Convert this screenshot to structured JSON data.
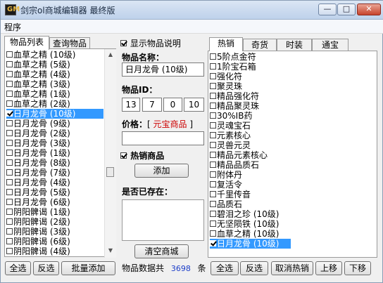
{
  "title": "剑宗ol商城编辑器 最终版",
  "app_icon_text": "GM",
  "window_buttons": {
    "min": "—",
    "max": "□",
    "close": "✕"
  },
  "menu": {
    "program": "程序"
  },
  "left": {
    "tabs": [
      "物品列表",
      "查询物品"
    ],
    "items": [
      "血草之精 (10级)",
      "血草之精 (5级)",
      "血草之精 (4级)",
      "血草之精 (3级)",
      "血草之精 (1级)",
      "血草之精 (2级)",
      "日月龙骨 (10级)",
      "日月龙骨 (9级)",
      "日月龙骨 (2级)",
      "日月龙骨 (3级)",
      "日月龙骨 (1级)",
      "日月龙骨 (8级)",
      "日月龙骨 (7级)",
      "日月龙骨 (4级)",
      "日月龙骨 (5级)",
      "日月龙骨 (6级)",
      "阴阳髀谒 (1级)",
      "阴阳髀谒 (2级)",
      "阴阳髀谒 (3级)",
      "阴阳髀谒 (6级)",
      "阴阳髀谒 (4级)"
    ],
    "selected_index": 6,
    "buttons": {
      "select_all": "全选",
      "invert": "反选",
      "batch_add": "批量添加"
    }
  },
  "middle": {
    "show_desc_label": "显示物品说明",
    "show_desc_checked": true,
    "name_label": "物品名称：",
    "name_value": "日月龙骨 (10级)",
    "id_label": "物品ID：",
    "id_values": [
      "13",
      "7",
      "0",
      "10"
    ],
    "price_label": "价格：",
    "price_bracket_open": "[",
    "price_currency": "元宝商品",
    "price_bracket_close": "]",
    "price_value": "",
    "hot_label": "热销商品",
    "hot_checked": true,
    "add_button": "添加",
    "exists_label": "是否已存在：",
    "clear_button": "清空商城",
    "count_label": "物品数据共",
    "count_value": "3698",
    "count_unit": "条"
  },
  "right": {
    "tabs": [
      "热销",
      "奇货",
      "时装",
      "通宝"
    ],
    "items": [
      "5阶点金符",
      "1阶宝石箱",
      "强化符",
      "聚灵珠",
      "精品强化符",
      "精品聚灵珠",
      "30%IB药",
      "灵魂宝石",
      "元素核心",
      "灵兽元灵",
      "精品元素核心",
      "精品品质石",
      "附体丹",
      "复活令",
      "千里传音",
      "品质石",
      "碧泪之珍 (10级)",
      "无坚陨铁 (10级)",
      "血草之精 (10级)",
      "日月龙骨 (10级)"
    ],
    "selected_index": 19,
    "buttons": {
      "select_all": "全选",
      "invert": "反选",
      "cancel_hot": "取消热销",
      "move_up": "上移",
      "move_down": "下移"
    }
  },
  "colors": {
    "selection": "#3399ff",
    "currency_text": "#cc0000",
    "count_text": "#1a3cc8"
  }
}
